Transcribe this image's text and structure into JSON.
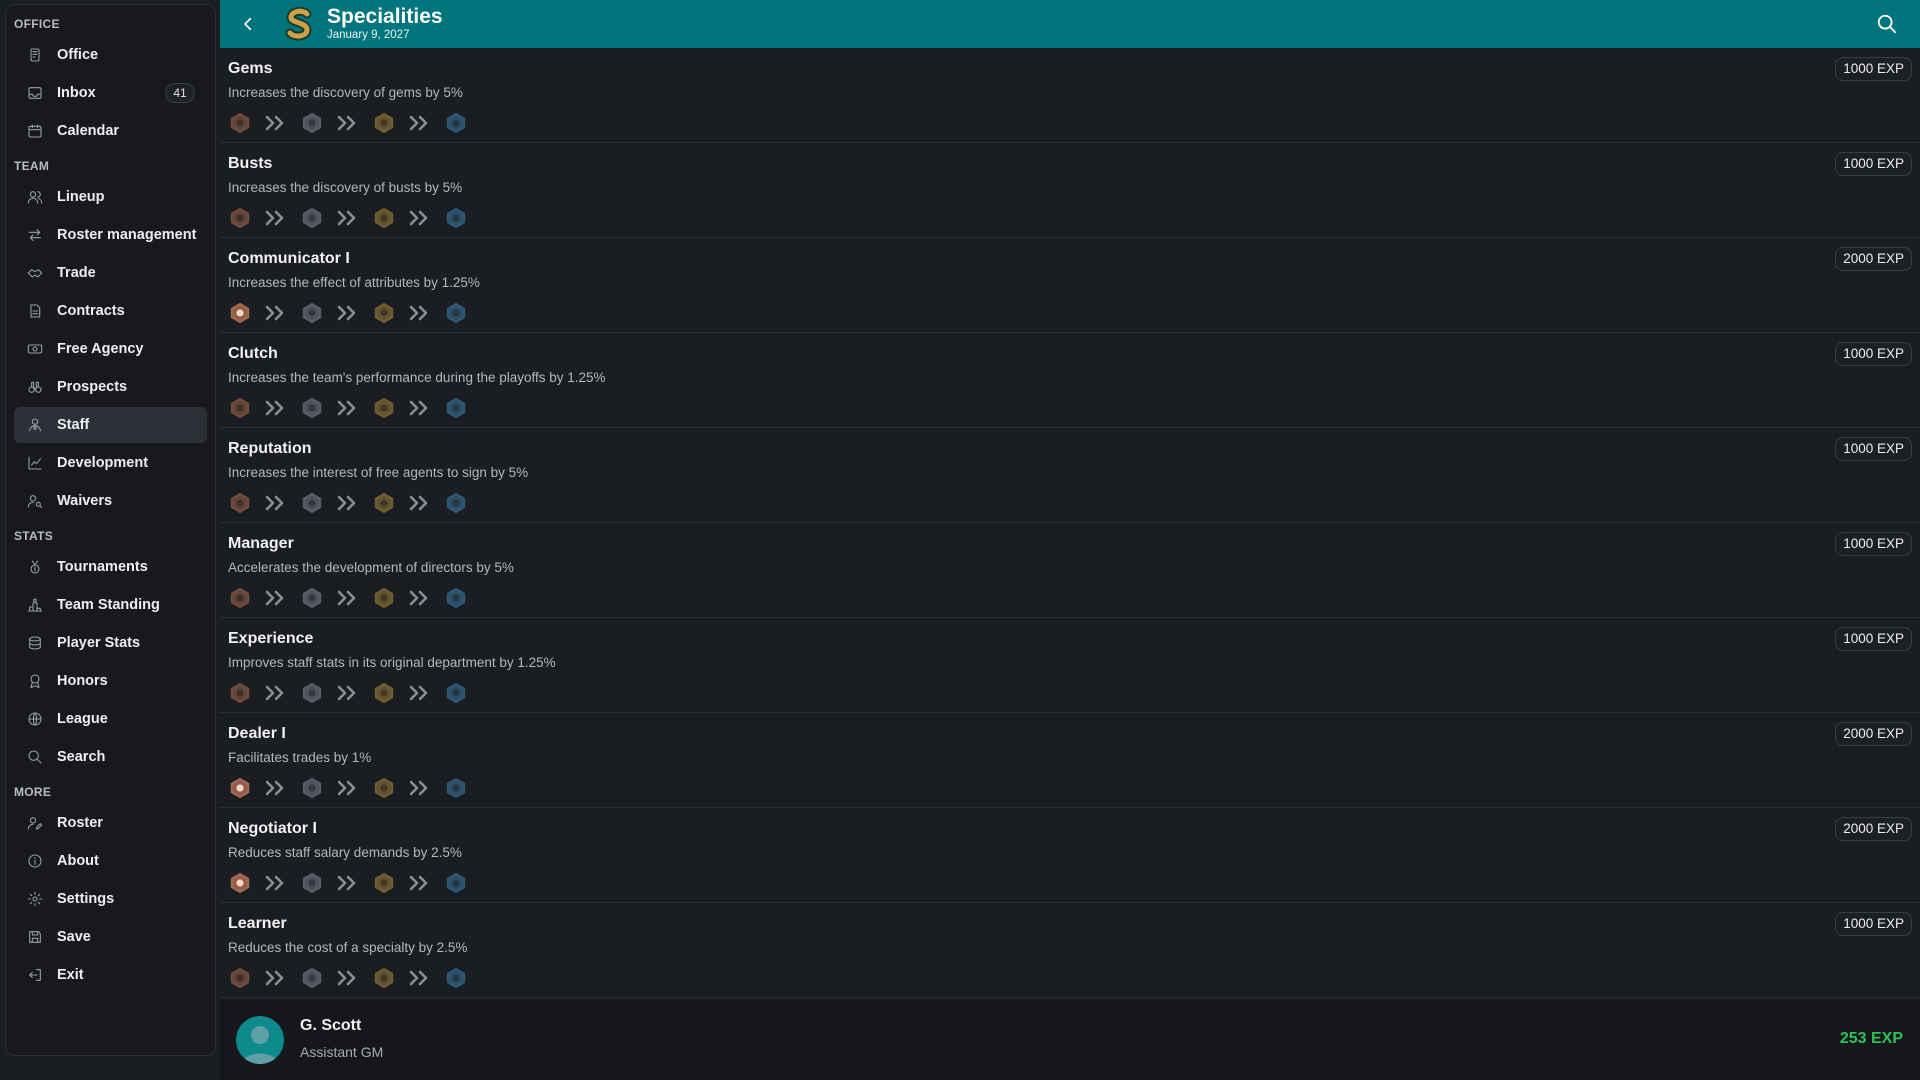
{
  "sidebar": {
    "sections": [
      {
        "title": "OFFICE",
        "items": [
          {
            "label": "Office",
            "icon": "phone-icon"
          },
          {
            "label": "Inbox",
            "icon": "inbox-icon",
            "badge": "41"
          },
          {
            "label": "Calendar",
            "icon": "calendar-icon"
          }
        ]
      },
      {
        "title": "TEAM",
        "items": [
          {
            "label": "Lineup",
            "icon": "users-icon"
          },
          {
            "label": "Roster management",
            "icon": "swap-icon"
          },
          {
            "label": "Trade",
            "icon": "handshake-icon"
          },
          {
            "label": "Contracts",
            "icon": "contract-icon"
          },
          {
            "label": "Free Agency",
            "icon": "money-icon"
          },
          {
            "label": "Prospects",
            "icon": "binoculars-icon"
          },
          {
            "label": "Staff",
            "icon": "staff-icon",
            "active": true
          },
          {
            "label": "Development",
            "icon": "chart-line-icon"
          },
          {
            "label": "Waivers",
            "icon": "user-search-icon"
          }
        ]
      },
      {
        "title": "STATS",
        "items": [
          {
            "label": "Tournaments",
            "icon": "medal-icon"
          },
          {
            "label": "Team Standing",
            "icon": "podium-icon"
          },
          {
            "label": "Player Stats",
            "icon": "database-icon"
          },
          {
            "label": "Honors",
            "icon": "award-icon"
          },
          {
            "label": "League",
            "icon": "globe-icon"
          },
          {
            "label": "Search",
            "icon": "search-icon"
          }
        ]
      },
      {
        "title": "MORE",
        "items": [
          {
            "label": "Roster",
            "icon": "user-edit-icon"
          },
          {
            "label": "About",
            "icon": "info-icon"
          },
          {
            "label": "Settings",
            "icon": "gear-icon"
          },
          {
            "label": "Save",
            "icon": "save-icon"
          },
          {
            "label": "Exit",
            "icon": "exit-icon"
          }
        ]
      }
    ]
  },
  "header": {
    "title": "Specialities",
    "date": "January 9, 2027",
    "back_icon": "chevron-left-icon",
    "logo_icon": "team-logo-icon",
    "search_icon": "search-icon",
    "color": "#00757b"
  },
  "specialities": [
    {
      "name": "Gems",
      "description": "Increases the discovery of gems by 5%",
      "cost": "1000 EXP",
      "acquired": 0
    },
    {
      "name": "Busts",
      "description": "Increases the discovery of busts by 5%",
      "cost": "1000 EXP",
      "acquired": 0
    },
    {
      "name": "Communicator I",
      "description": "Increases the effect of attributes by 1.25%",
      "cost": "2000 EXP",
      "acquired": 1
    },
    {
      "name": "Clutch",
      "description": "Increases the team's performance during the playoffs by 1.25%",
      "cost": "1000 EXP",
      "acquired": 0
    },
    {
      "name": "Reputation",
      "description": "Increases the interest of free agents to sign by 5%",
      "cost": "1000 EXP",
      "acquired": 0
    },
    {
      "name": "Manager",
      "description": "Accelerates the development of directors by 5%",
      "cost": "1000 EXP",
      "acquired": 0
    },
    {
      "name": "Experience",
      "description": "Improves staff stats in its original department by 1.25%",
      "cost": "1000 EXP",
      "acquired": 0
    },
    {
      "name": "Dealer I",
      "description": "Facilitates trades by 1%",
      "cost": "2000 EXP",
      "acquired": 1
    },
    {
      "name": "Negotiator I",
      "description": "Reduces staff salary demands by 2.5%",
      "cost": "2000 EXP",
      "acquired": 1
    },
    {
      "name": "Learner",
      "description": "Reduces the cost of a specialty by 2.5%",
      "cost": "1000 EXP",
      "acquired": 0
    }
  ],
  "tier_colors": {
    "bronze": "#a36a52",
    "silver": "#7c858f",
    "gold": "#a58542",
    "blue": "#3f7da6"
  },
  "footer": {
    "name": "G. Scott",
    "role": "Assistant GM",
    "exp": "253 EXP",
    "exp_color": "#2ec15b",
    "avatar_icon": "avatar-icon"
  }
}
